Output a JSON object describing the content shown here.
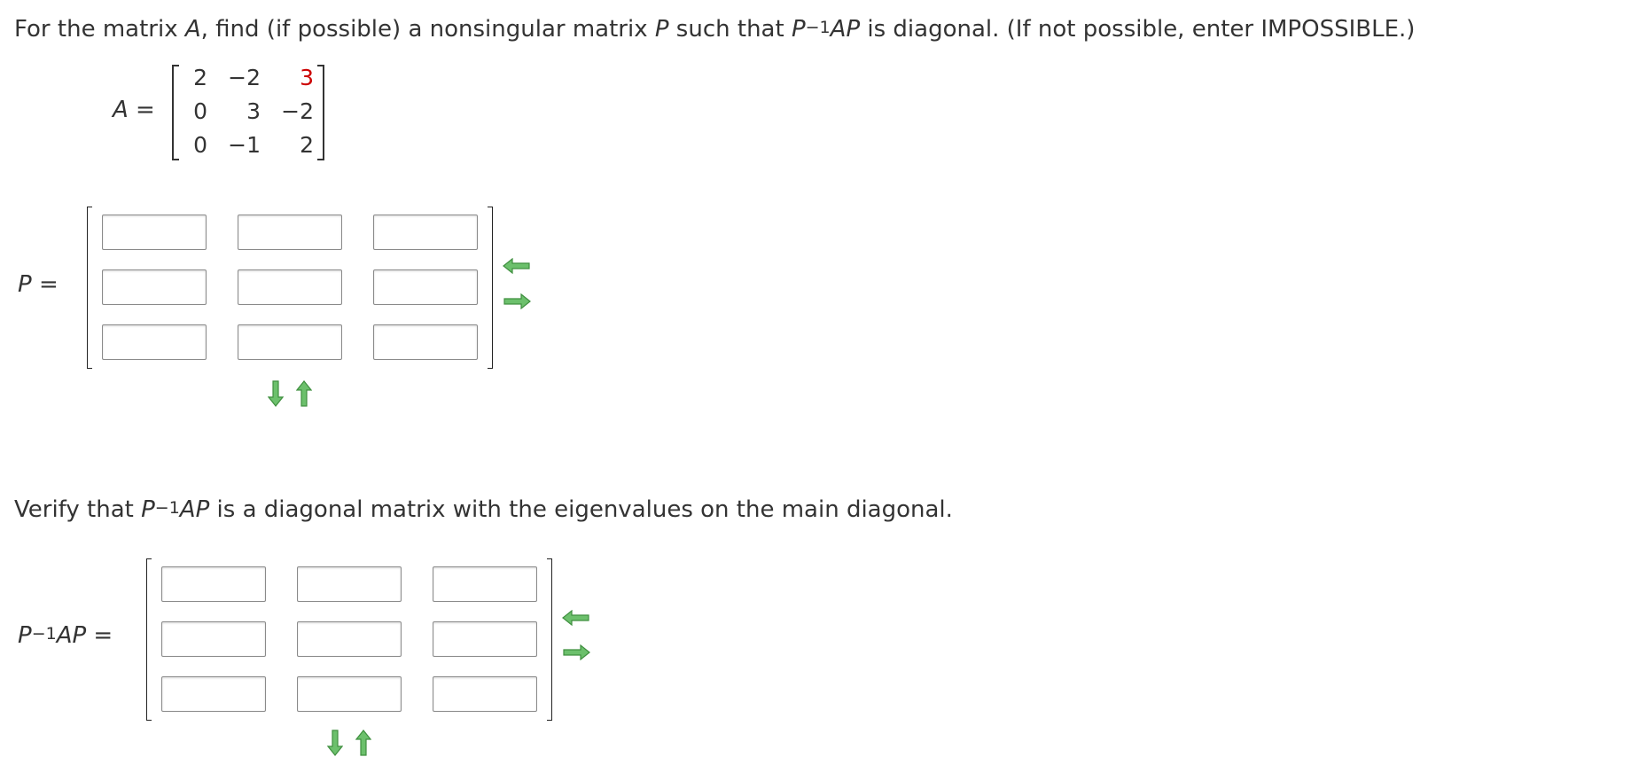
{
  "question": {
    "part1": "For the matrix ",
    "var_A": "A",
    "part2": ", find (if possible) a nonsingular matrix ",
    "var_P": "P",
    "part3": " such that ",
    "expr_P": "P",
    "expr_exp": "−1",
    "expr_AP": "AP",
    "part4": " is diagonal. (If not possible, enter IMPOSSIBLE.)"
  },
  "matrix_A": {
    "label_var": "A",
    "label_eq": " =",
    "rows": [
      [
        "2",
        "−2",
        "3"
      ],
      [
        "0",
        "3",
        "−2"
      ],
      [
        "0",
        "−1",
        "2"
      ]
    ],
    "highlight_color": "#cc0000"
  },
  "matrix_P": {
    "label_var": "P",
    "label_eq": " ="
  },
  "verify": {
    "part1": "Verify that ",
    "expr_P": "P",
    "expr_exp": "−1",
    "expr_AP": "AP",
    "part2": " is a diagonal matrix with the eigenvalues on the main diagonal."
  },
  "matrix_PAP": {
    "label_P": "P",
    "label_exp": "−1",
    "label_AP": "AP",
    "label_eq": " ="
  },
  "icons": {
    "remove_column": "arrow-left-icon",
    "add_column": "arrow-right-icon",
    "add_row": "arrow-down-icon",
    "remove_row": "arrow-up-icon"
  },
  "colors": {
    "arrow_fill": "#6cc06c",
    "arrow_stroke": "#3f8f3f"
  }
}
